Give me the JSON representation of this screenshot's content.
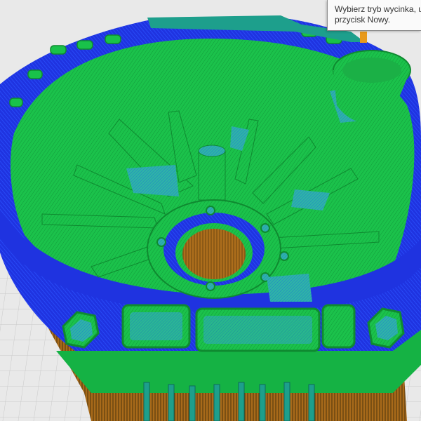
{
  "app": {
    "view": "slice-preview",
    "colors": {
      "background": "#e9e9e9",
      "grid_line": "#c9c9c9",
      "wall_outer": "#1f33e0",
      "infill_green": "#19c24a",
      "infill_green_dark": "#0f8a30",
      "infill_cyan": "#2fb5a6",
      "support_orange": "#b8761f",
      "support_dark": "#6b4a14",
      "travel_teal": "#1d9f8c"
    }
  },
  "tooltip": {
    "line1": "Wybierz tryb wycinka, używ",
    "line2": "przycisk Nowy."
  }
}
